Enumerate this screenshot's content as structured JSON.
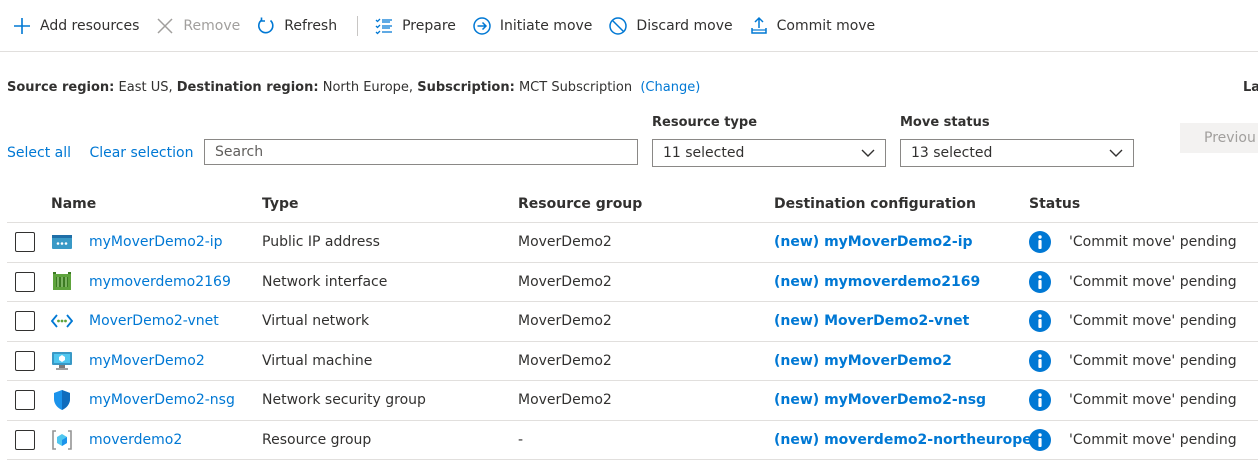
{
  "toolbar": {
    "add_resources": "Add resources",
    "remove": "Remove",
    "refresh": "Refresh",
    "prepare": "Prepare",
    "initiate_move": "Initiate move",
    "discard_move": "Discard move",
    "commit_move": "Commit move"
  },
  "region": {
    "source_label": "Source region:",
    "source_value": "East US,",
    "dest_label": "Destination region:",
    "dest_value": "North Europe,",
    "sub_label": "Subscription:",
    "sub_value": "MCT Subscription",
    "change_link": "(Change)",
    "cut_text": "La"
  },
  "filters": {
    "select_all": "Select all",
    "clear_selection": "Clear selection",
    "search_placeholder": "Search",
    "resource_type_label": "Resource type",
    "resource_type_value": "11 selected",
    "move_status_label": "Move status",
    "move_status_value": "13 selected",
    "previous": "Previou"
  },
  "table": {
    "headers": {
      "name": "Name",
      "type": "Type",
      "resource_group": "Resource group",
      "destination": "Destination configuration",
      "status": "Status"
    },
    "rows": [
      {
        "icon": "public-ip-icon",
        "name": "myMoverDemo2-ip",
        "type": "Public IP address",
        "rg": "MoverDemo2",
        "dest": "(new) myMoverDemo2-ip",
        "status": "'Commit move' pending"
      },
      {
        "icon": "network-interface-icon",
        "name": "mymoverdemo2169",
        "type": "Network interface",
        "rg": "MoverDemo2",
        "dest": "(new) mymoverdemo2169",
        "status": "'Commit move' pending"
      },
      {
        "icon": "virtual-network-icon",
        "name": "MoverDemo2-vnet",
        "type": "Virtual network",
        "rg": "MoverDemo2",
        "dest": "(new) MoverDemo2-vnet",
        "status": "'Commit move' pending"
      },
      {
        "icon": "virtual-machine-icon",
        "name": "myMoverDemo2",
        "type": "Virtual machine",
        "rg": "MoverDemo2",
        "dest": "(new) myMoverDemo2",
        "status": "'Commit move' pending"
      },
      {
        "icon": "nsg-shield-icon",
        "name": "myMoverDemo2-nsg",
        "type": "Network security group",
        "rg": "MoverDemo2",
        "dest": "(new) myMoverDemo2-nsg",
        "status": "'Commit move' pending"
      },
      {
        "icon": "resource-group-icon",
        "name": "moverdemo2",
        "type": "Resource group",
        "rg": "-",
        "dest": "(new) moverdemo2-northeurope",
        "status": "'Commit move' pending"
      }
    ]
  },
  "colors": {
    "link": "#0078d4",
    "info": "#0078d4",
    "disabled": "#a19f9d"
  }
}
